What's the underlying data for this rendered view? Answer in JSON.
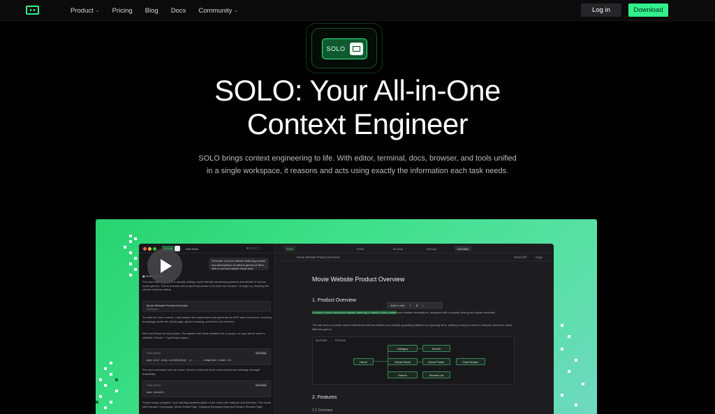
{
  "nav": {
    "links": [
      {
        "label": "Product",
        "chevron": true
      },
      {
        "label": "Pricing",
        "chevron": false
      },
      {
        "label": "Blog",
        "chevron": false
      },
      {
        "label": "Docs",
        "chevron": false
      },
      {
        "label": "Community",
        "chevron": true
      }
    ],
    "login": "Log in",
    "download": "Download"
  },
  "hero": {
    "badge": "SOLO",
    "title_line1": "SOLO: Your All-in-One",
    "title_line2": "Context Engineer",
    "sub_line1": "SOLO brings context engineering to life. With editor, terminal, docs, browser, and tools unified",
    "sub_line2": "in a single workspace, it reasons and acts using exactly the information each task needs."
  },
  "app": {
    "left": {
      "chip_solo": "SOLO",
      "project": "trae-demo",
      "prompt": "Generate a movie website featuring posters and descriptions of various genres of films, with a cool and stylish visual style.",
      "builder_label": "SOLO Builder",
      "para1": "The user wants to create a visually striking movie website showcasing posters and details of various movie genres. This is a brand-new project that needs to be built from scratch. I'll begin by checking the current directory status.",
      "card1_title": "Movie Website Product Overview",
      "card1_sub": "markdown",
      "para2": "To meet the user's needs, I will analyze the requirement and generate an MVP spec document, including homepage movie list, detail page, genre browsing, and other core features.",
      "para3": "We'll use React for this project. The system has Node installed but no pnpm, so npm will be used to initialize a React + TypeScript project.",
      "term1_label": "Solo-Demo",
      "term1_tag": "Terminal",
      "term1_cmd": "npm init vite-init@latest -y . -- --template react-ts",
      "para4": "The npm command was not found. Need to verify the Node environment and package manager availability.",
      "term2_label": "Solo-Demo",
      "term2_tag": "Terminal",
      "term2_cmd": "npm install",
      "para5": "Project setup complete. Now starting implementation of the movie site features and interface. The movie site includes: Homepage, Movie Detail Page, Category Browsing Page and Search Results Page."
    },
    "right": {
      "flow_tab": "Flow",
      "tabs": [
        "Editor",
        "Terminal",
        "Browser",
        "DocView"
      ],
      "doc_name": "Movie Website Product Overview",
      "show_diff": "Show Diff",
      "copy": "Copy",
      "h1": "Movie Website Product Overview",
      "h2_1": "1. Product Overview",
      "toolbar_add": "Add to chat",
      "toolbar_t": "T",
      "toolbar_b": "B",
      "toolbar_i": "I",
      "p1_highlight": "A modern movie showcase website featuring a variety of film posters",
      "p1_rest": " and detailed descriptions, designed with a visually striking and stylish aesthetic.",
      "p2": "The site aims to provide movie enthusiasts with an intuitive and visually appealing platform for exploring films, making it easy for users to discover and learn about different genres.",
      "diagram_tabs": [
        "Mermaid",
        "Preview"
      ],
      "nodes": [
        "Home",
        "Category",
        "Movie Detail",
        "Search",
        "Search",
        "Movie Poster",
        "Results List",
        "Cast Section"
      ],
      "h2_2": "2. Features",
      "h3": "2.1 Overview"
    }
  }
}
